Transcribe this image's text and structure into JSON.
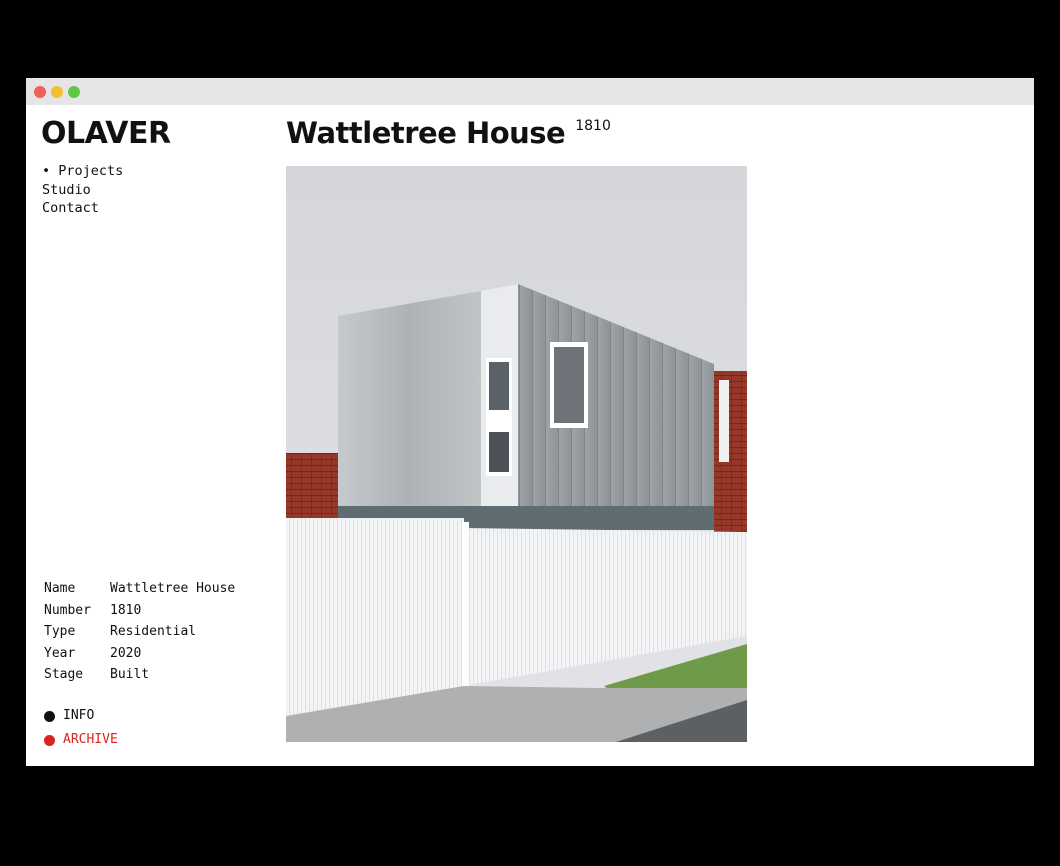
{
  "window": {
    "controls": [
      "close",
      "minimize",
      "zoom"
    ]
  },
  "site": {
    "logo": "OLAVER"
  },
  "nav": {
    "items": [
      {
        "label": "• Projects",
        "active": true
      },
      {
        "label": "Studio"
      },
      {
        "label": "Contact"
      }
    ]
  },
  "project": {
    "title": "Wattletree House",
    "number": "1810",
    "details": [
      {
        "key": "Name",
        "value": "Wattletree House"
      },
      {
        "key": "Number",
        "value": "1810"
      },
      {
        "key": "Type",
        "value": "Residential"
      },
      {
        "key": "Year",
        "value": "2020"
      },
      {
        "key": "Stage",
        "value": "Built"
      }
    ]
  },
  "links": {
    "info": {
      "label": "INFO",
      "color": "#111111"
    },
    "archive": {
      "label": "ARCHIVE",
      "color": "#d9261c"
    }
  }
}
